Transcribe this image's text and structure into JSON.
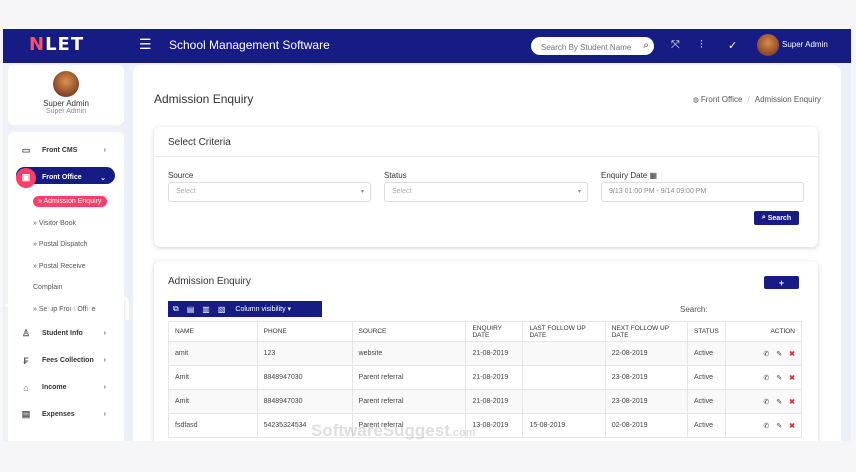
{
  "topbar": {
    "logo_n": "N",
    "logo_rest": "LET",
    "title": "School Management Software",
    "search_placeholder": "Search By Student Name",
    "user": "Super Admin"
  },
  "profile": {
    "name": "Super Admin",
    "role": "Super Admin"
  },
  "sidebar": {
    "items": [
      {
        "label": "Front CMS",
        "icon": "monitor-icon"
      },
      {
        "label": "Front Office",
        "icon": "briefcase-icon"
      },
      {
        "label": "Student Info",
        "icon": "user-icon"
      },
      {
        "label": "Fees Collection",
        "icon": "receipt-icon"
      },
      {
        "label": "Income",
        "icon": "building-icon"
      },
      {
        "label": "Expenses",
        "icon": "wallet-icon"
      }
    ],
    "sub_items": [
      "» Admission Enquiry",
      "» Visitor Book",
      "» Postal Dispatch",
      "» Postal Receive",
      "Complain",
      "» Setup Front Office"
    ]
  },
  "page": {
    "title": "Admission Enquiry",
    "breadcrumb": [
      "Front Office",
      "Admission Enquiry"
    ]
  },
  "criteria": {
    "title": "Select Criteria",
    "source_label": "Source",
    "source_value": "Select",
    "status_label": "Status",
    "status_value": "Select",
    "date_label": "Enquiry Date",
    "date_value": "9/13 01:00 PM - 9/14 09:00 PM",
    "search_btn": "Search"
  },
  "enquiry": {
    "title": "Admission Enquiry",
    "add_btn": "+",
    "column_visibility": "Column visibility",
    "search_label": "Search:",
    "columns": [
      "NAME",
      "PHONE",
      "SOURCE",
      "ENQUIRY DATE",
      "LAST FOLLOW UP DATE",
      "NEXT FOLLOW UP DATE",
      "STATUS",
      "ACTION"
    ],
    "rows": [
      [
        "amit",
        "123",
        "website",
        "21-08-2019",
        "",
        "22-08-2019",
        "Active"
      ],
      [
        "Amit",
        "8848947030",
        "Parent referral",
        "21-08-2019",
        "",
        "23-08-2019",
        "Active"
      ],
      [
        "Amit",
        "8848947030",
        "Parent referral",
        "21-08-2019",
        "",
        "23-08-2019",
        "Active"
      ],
      [
        "fsdfasd",
        "54235324534",
        "Parent referral",
        "13-08-2019",
        "15-08-2019",
        "02-08-2019",
        "Active"
      ]
    ]
  },
  "watermark": {
    "overlay": "+.com",
    "brand": "SoftwareSuggest",
    "brand_suffix": ".com"
  },
  "colors": {
    "primary": "#161c83",
    "accent": "#ff3f6a",
    "delete": "#e0334b"
  }
}
